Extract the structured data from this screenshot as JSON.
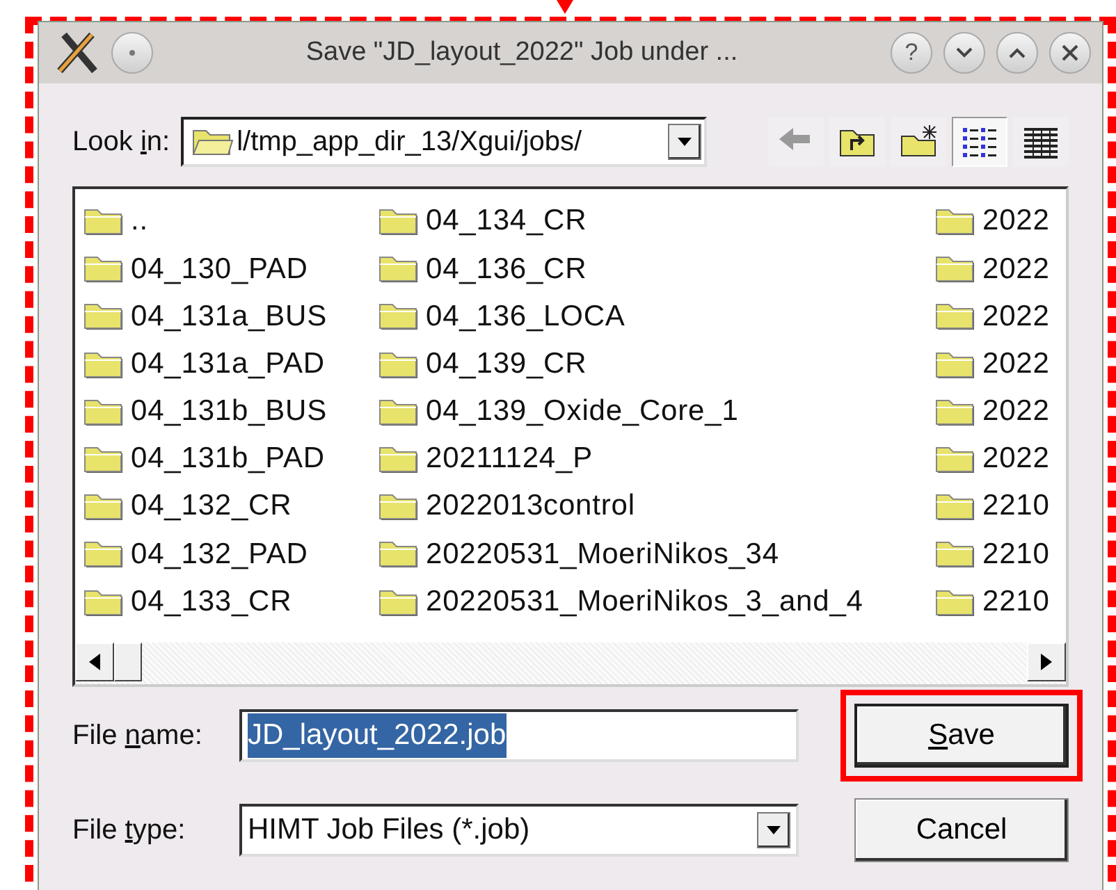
{
  "annotation": {
    "dotted_frame": true,
    "pointer_arrow": true
  },
  "window": {
    "title": "Save \"JD_layout_2022\" Job under ...",
    "title_buttons": [
      {
        "kind": "help",
        "label": "?"
      },
      {
        "kind": "minimize"
      },
      {
        "kind": "maximize"
      },
      {
        "kind": "close"
      }
    ]
  },
  "look_in": {
    "label": {
      "before": "Look ",
      "key": "i",
      "after": "n:"
    },
    "value": "l/tmp_app_dir_13/Xgui/jobs/"
  },
  "toolbar": [
    {
      "kind": "back",
      "disabled": true
    },
    {
      "kind": "up",
      "disabled": false
    },
    {
      "kind": "new_folder",
      "disabled": false
    },
    {
      "kind": "list_view",
      "selected": true
    },
    {
      "kind": "detail_view",
      "selected": false
    }
  ],
  "files": {
    "columns": [
      [
        "..",
        "04_130_PAD",
        "04_131a_BUS",
        "04_131a_PAD",
        "04_131b_BUS",
        "04_131b_PAD",
        "04_132_CR",
        "04_132_PAD",
        "04_133_CR"
      ],
      [
        "04_134_CR",
        "04_136_CR",
        "04_136_LOCA",
        "04_139_CR",
        "04_139_Oxide_Core_1",
        "20211124_P",
        "2022013control",
        "20220531_MoeriNikos_34",
        "20220531_MoeriNikos_3_and_4"
      ],
      [
        "2022",
        "2022",
        "2022",
        "2022",
        "2022",
        "2022",
        "2210",
        "2210",
        "2210"
      ]
    ]
  },
  "file_name": {
    "label": {
      "before": "File ",
      "key": "n",
      "after": "ame:"
    },
    "value": "JD_layout_2022.job",
    "text_selected": true
  },
  "file_type": {
    "label": {
      "before": "File ",
      "key": "t",
      "after": "ype:"
    },
    "value": "HIMT Job Files (*.job)"
  },
  "buttons": [
    {
      "default": true,
      "label": {
        "key": "S",
        "after": "ave"
      },
      "highlighted": true
    },
    {
      "default": false,
      "label": {
        "before": "Cancel"
      },
      "highlighted": false
    }
  ]
}
